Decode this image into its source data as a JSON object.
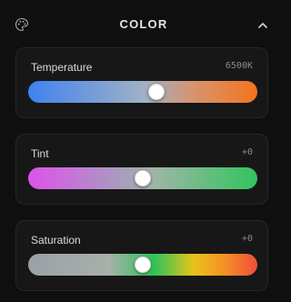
{
  "header": {
    "title": "COLOR",
    "palette_icon": "palette-icon",
    "collapse_icon": "chevron-up-icon"
  },
  "controls": [
    {
      "label": "Temperature",
      "value_text": "6500K",
      "level": 0.56,
      "gradient": [
        "#3f82f0",
        "#9fb1c6",
        "#d69470",
        "#f5731c"
      ]
    },
    {
      "label": "Tint",
      "value_text": "+0",
      "level": 0.5,
      "gradient": [
        "#dd52ea",
        "#a99bc0",
        "#9fb5a6",
        "#32c45e"
      ]
    },
    {
      "label": "Saturation",
      "value_text": "+0",
      "level": 0.5,
      "gradient": [
        "#9aa1a8",
        "#2fc25a",
        "#e7c41a",
        "#f69325",
        "#f04d3a"
      ]
    }
  ],
  "colors": {
    "background": "#0f0f0f",
    "card": "#171717",
    "card_border": "#262626",
    "thumb": "#ffffff"
  }
}
